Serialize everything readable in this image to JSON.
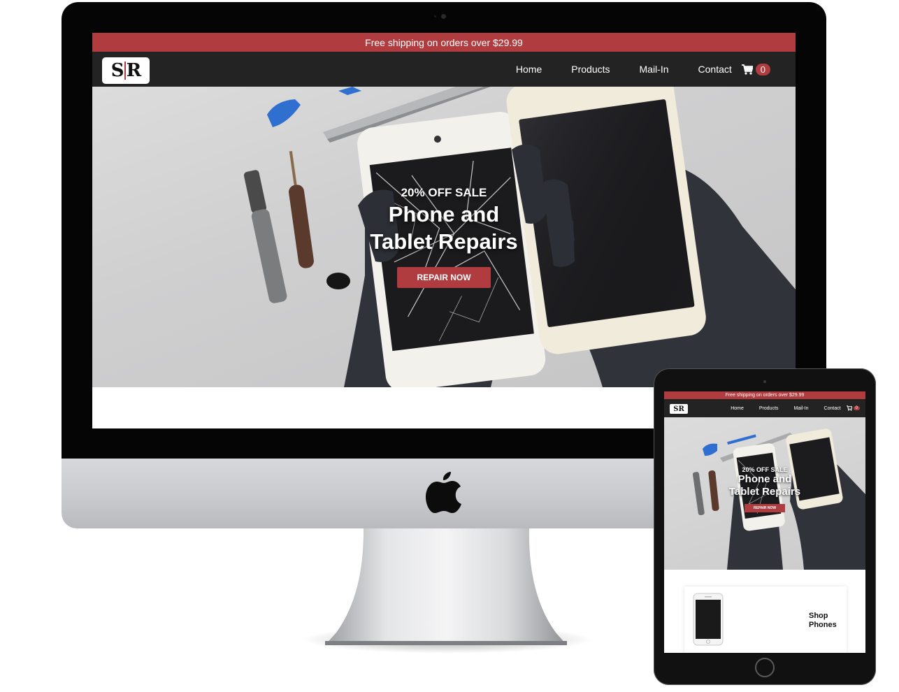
{
  "desktop": {
    "promo_bar": "Free shipping on orders over $29.99",
    "logo": {
      "letters_left": "S",
      "letters_right": "R"
    },
    "nav": {
      "items": [
        {
          "label": "Home"
        },
        {
          "label": "Products"
        },
        {
          "label": "Mail-In"
        },
        {
          "label": "Contact"
        }
      ],
      "cart_count": "0"
    },
    "hero": {
      "sale": "20% OFF SALE",
      "title_line1": "Phone and",
      "title_line2": "Tablet Repairs",
      "cta": "REPAIR NOW"
    }
  },
  "tablet": {
    "promo_bar": "Free shipping on orders over $29.99",
    "logo": {
      "letters_left": "S",
      "letters_right": "R"
    },
    "nav": {
      "items": [
        {
          "label": "Home"
        },
        {
          "label": "Products"
        },
        {
          "label": "Mail-In"
        },
        {
          "label": "Contact"
        }
      ],
      "cart_count": "0"
    },
    "hero": {
      "sale": "20% OFF SALE",
      "title_line1": "Phone and",
      "title_line2": "Tablet Repairs",
      "cta": "REPAIR NOW"
    },
    "card": {
      "line1": "Shop",
      "line2": "Phones"
    }
  },
  "colors": {
    "brand_red": "#b03c3f",
    "nav_dark": "#232323",
    "device_black": "#050505",
    "aluminum": "#c9cacd"
  },
  "icons": [
    "cart-icon",
    "apple-logo-icon",
    "camera-icon",
    "home-button-icon"
  ]
}
